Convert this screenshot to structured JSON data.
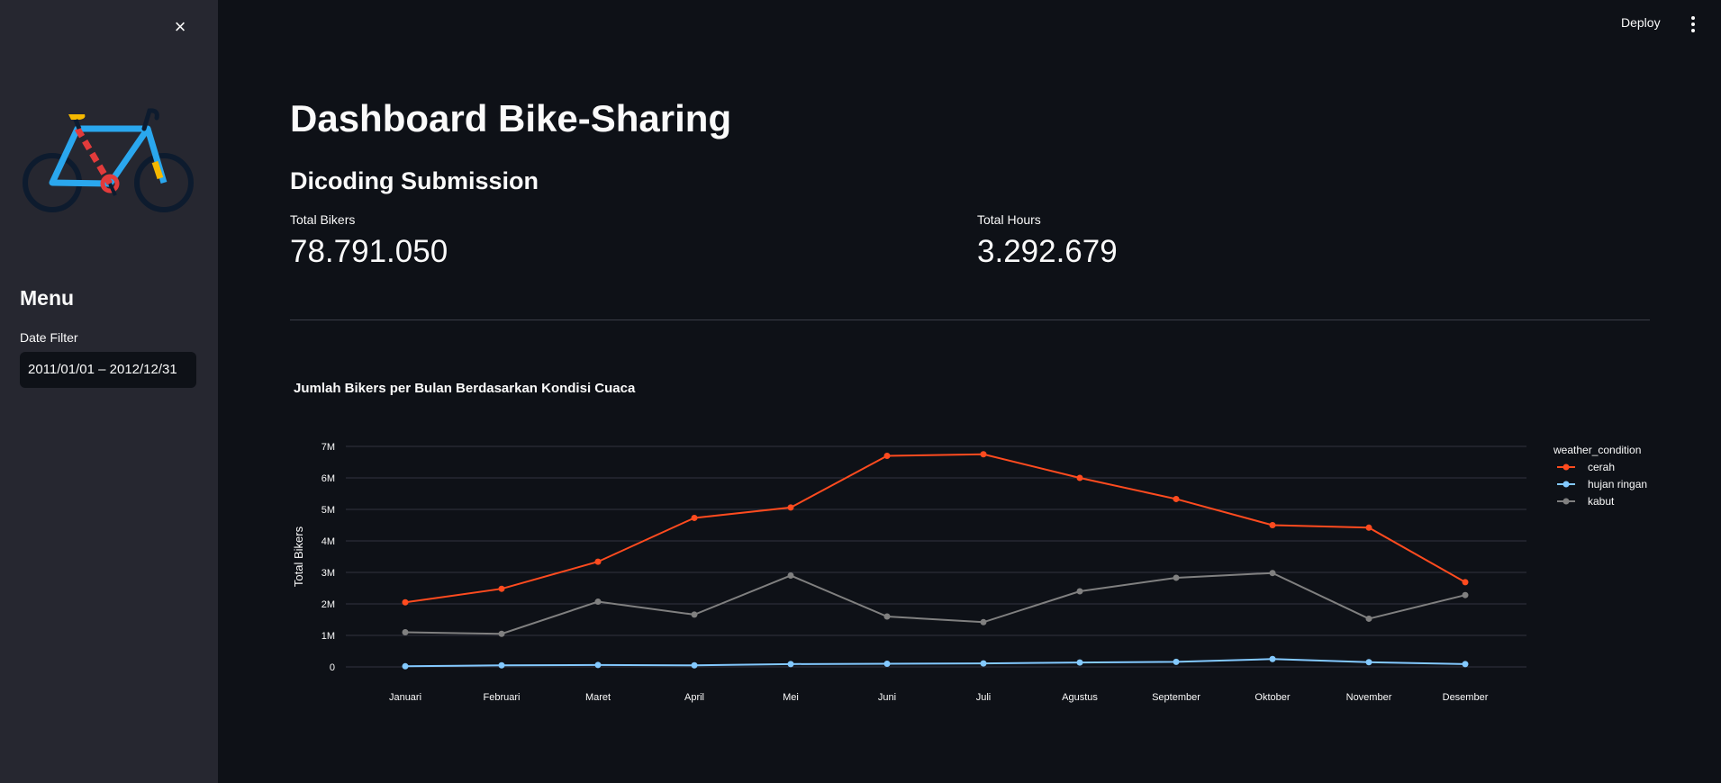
{
  "sidebar": {
    "close_label": "×",
    "menu_title": "Menu",
    "date_filter": {
      "label": "Date Filter",
      "value": "2011/01/01 – 2012/12/31"
    }
  },
  "header": {
    "deploy_label": "Deploy"
  },
  "main": {
    "title": "Dashboard Bike-Sharing",
    "subtitle": "Dicoding Submission",
    "metrics": [
      {
        "label": "Total Bikers",
        "value": "78.791.050"
      },
      {
        "label": "Total Hours",
        "value": "3.292.679"
      }
    ]
  },
  "icons": {
    "close": "close-icon",
    "menu": "kebab-menu-icon",
    "logo": "bicycle-icon"
  },
  "chart_data": {
    "type": "line",
    "title": "Jumlah Bikers per Bulan Berdasarkan Kondisi Cuaca",
    "xlabel": "",
    "ylabel": "Total Bikers",
    "categories": [
      "Januari",
      "Februari",
      "Maret",
      "April",
      "Mei",
      "Juni",
      "Juli",
      "Agustus",
      "September",
      "Oktober",
      "November",
      "Desember"
    ],
    "yticks": [
      {
        "value": 0,
        "label": "0"
      },
      {
        "value": 1000000,
        "label": "1M"
      },
      {
        "value": 2000000,
        "label": "2M"
      },
      {
        "value": 3000000,
        "label": "3M"
      },
      {
        "value": 4000000,
        "label": "4M"
      },
      {
        "value": 5000000,
        "label": "5M"
      },
      {
        "value": 6000000,
        "label": "6M"
      },
      {
        "value": 7000000,
        "label": "7M"
      }
    ],
    "ylim": [
      0,
      7000000
    ],
    "grid": true,
    "legend": {
      "title": "weather_condition",
      "placement": "right"
    },
    "series": [
      {
        "name": "cerah",
        "color": "#ff4b1f",
        "values": [
          2050000,
          2480000,
          3340000,
          4730000,
          5060000,
          6700000,
          6750000,
          6000000,
          5330000,
          4500000,
          4420000,
          2690000
        ]
      },
      {
        "name": "hujan ringan",
        "color": "#83c9ff",
        "values": [
          20000,
          50000,
          60000,
          50000,
          90000,
          100000,
          110000,
          140000,
          160000,
          250000,
          150000,
          90000
        ]
      },
      {
        "name": "kabut",
        "color": "#808080",
        "values": [
          1100000,
          1050000,
          2070000,
          1660000,
          2900000,
          1600000,
          1420000,
          2400000,
          2830000,
          2980000,
          1530000,
          2280000
        ]
      }
    ]
  }
}
